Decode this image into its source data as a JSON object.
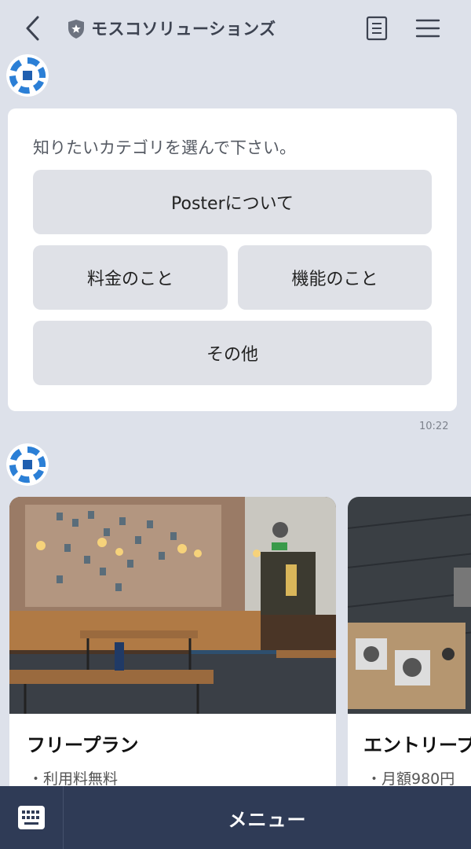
{
  "header": {
    "title": "モスコソリューションズ",
    "back_icon": "chevron-left-icon",
    "badge_icon": "shield-star-icon",
    "notes_icon": "note-icon",
    "menu_icon": "hamburger-menu-icon"
  },
  "message": {
    "prompt": "知りたいカテゴリを選んで下さい。",
    "options": [
      {
        "label": "Posterについて"
      },
      {
        "label": "料金のこと"
      },
      {
        "label": "機能のこと"
      },
      {
        "label": "その他"
      }
    ],
    "time": "10:22"
  },
  "carousel": {
    "cards": [
      {
        "title": "フリープラン",
        "item": "・利用料無料"
      },
      {
        "title": "エントリープ",
        "item": "・月額980円"
      }
    ]
  },
  "bottom_bar": {
    "keyboard_icon": "keyboard-icon",
    "menu_label": "メニュー"
  },
  "colors": {
    "background": "#dde1ea",
    "bottom_bar": "#2f3b56",
    "button": "#dfe1e7"
  }
}
